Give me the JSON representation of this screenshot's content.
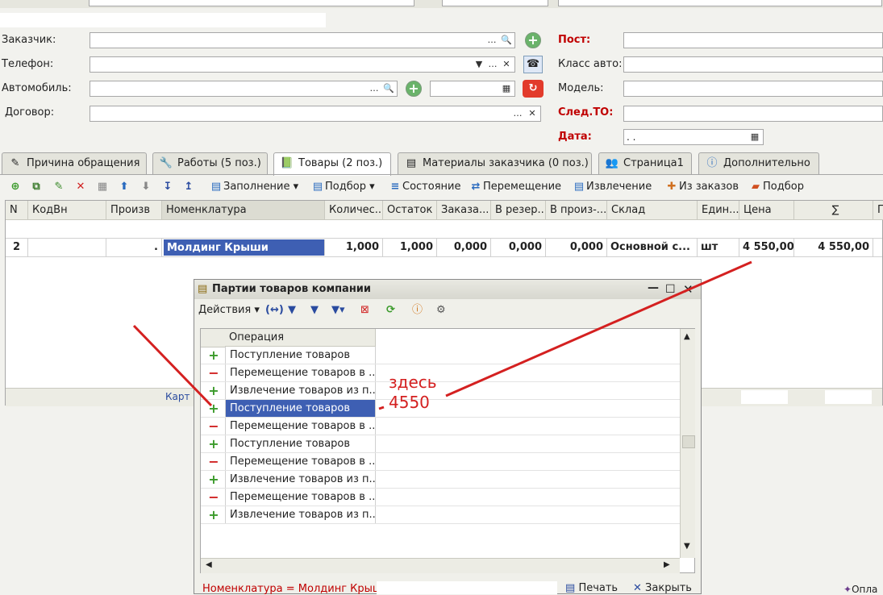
{
  "header": {
    "customer_label": "Заказчик:",
    "phone_label": "Телефон:",
    "car_label": "Автомобиль:",
    "contract_label": "Договор:",
    "post_label": "Пост:",
    "car_class_label": "Класс авто:",
    "model_label": "Модель:",
    "next_to_label": "След.ТО:",
    "date_label": "Дата:",
    "date_value": ". ."
  },
  "tabs": [
    {
      "label": "Причина обращения",
      "icon": "pencil-icon"
    },
    {
      "label": "Работы (5 поз.)",
      "icon": "wrench-icon"
    },
    {
      "label": "Товары (2 поз.)",
      "icon": "books-icon"
    },
    {
      "label": "Материалы заказчика (0 поз.)",
      "icon": "materials-icon"
    },
    {
      "label": "Страница1",
      "icon": "people-icon"
    },
    {
      "label": "Дополнительно",
      "icon": "info-icon"
    }
  ],
  "toolbar": {
    "fill_label": "Заполнение",
    "select_label": "Подбор",
    "state_label": "Состояние",
    "move_label": "Перемещение",
    "extract_label": "Извлечение",
    "from_orders_label": "Из заказов",
    "pick_label": "Подбор"
  },
  "grid": {
    "columns": [
      "N",
      "КодВн",
      "Произв",
      "Номенклатура",
      "Количес...",
      "Остаток",
      "Заказа...",
      "В резер...",
      "В произ-...",
      "Склад",
      "Един...",
      "Цена",
      "∑",
      "П"
    ],
    "row": {
      "n": "2",
      "code": "",
      "mfr": ".",
      "item": "Молдинг Крыши",
      "qty": "1,000",
      "rest": "1,000",
      "ordered": "0,000",
      "reserved": "0,000",
      "inprod": "0,000",
      "warehouse": "Основной с...",
      "unit": "шт",
      "price": "4 550,00",
      "sum": "4 550,00"
    },
    "footer_text": "Карт"
  },
  "dialog": {
    "title": "Партии товаров компании",
    "actions_label": "Действия",
    "column_header": "Операция",
    "rows": [
      {
        "sign": "+",
        "text": "Поступление товаров",
        "selected": false
      },
      {
        "sign": "−",
        "text": "Перемещение товаров в ...",
        "selected": false
      },
      {
        "sign": "+",
        "text": "Извлечение товаров из п...",
        "selected": false
      },
      {
        "sign": "+",
        "text": "Поступление товаров",
        "selected": true
      },
      {
        "sign": "−",
        "text": "Перемещение товаров в ...",
        "selected": false
      },
      {
        "sign": "+",
        "text": "Поступление товаров",
        "selected": false
      },
      {
        "sign": "−",
        "text": "Перемещение товаров в ...",
        "selected": false
      },
      {
        "sign": "+",
        "text": "Извлечение товаров из п...",
        "selected": false
      },
      {
        "sign": "−",
        "text": "Перемещение товаров в ...",
        "selected": false
      },
      {
        "sign": "+",
        "text": "Извлечение товаров из п...",
        "selected": false
      }
    ],
    "status_text": "Номенклатура = Молдинг Крыши",
    "print_label": "Печать",
    "close_label": "Закрыть"
  },
  "annotation": {
    "line1": "здесь",
    "line2": "4550",
    "color": "#d42020"
  },
  "corner_text": "Опла"
}
